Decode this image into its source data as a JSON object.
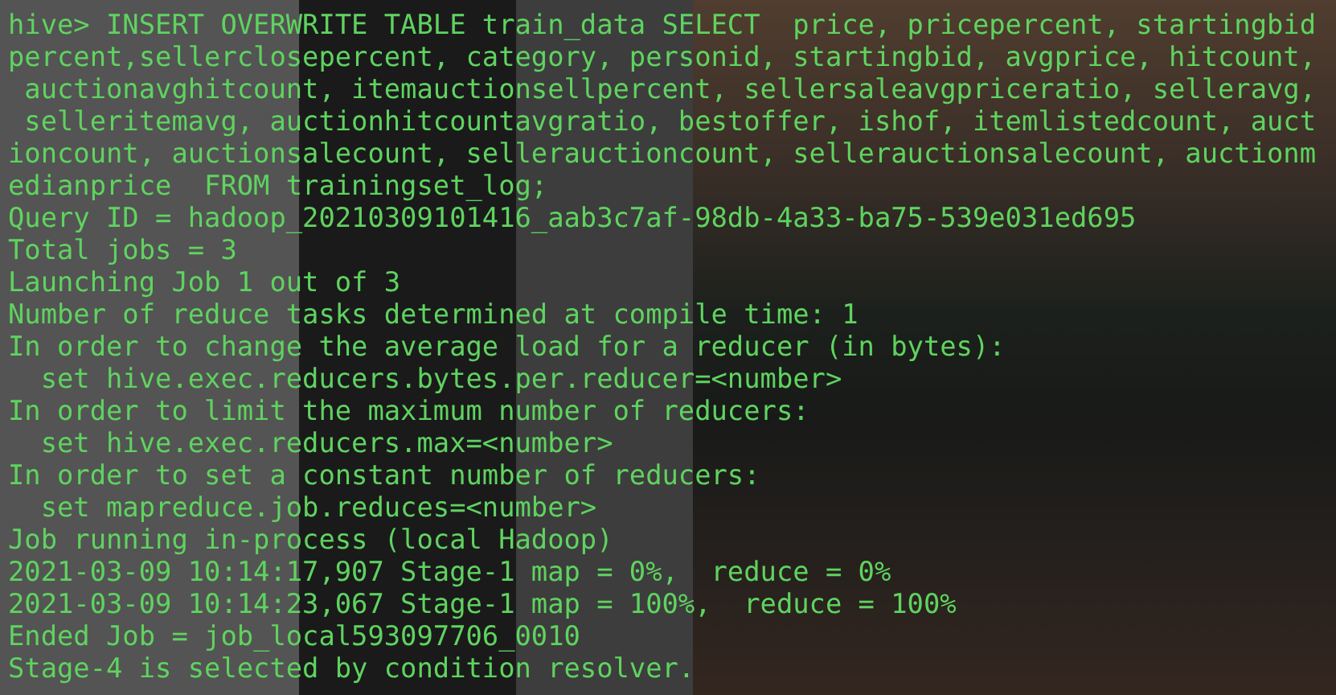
{
  "terminal": {
    "lines": [
      "hive> INSERT OVERWRITE TABLE train_data SELECT  price, pricepercent, startingbid",
      "percent,sellerclosepercent, category, personid, startingbid, avgprice, hitcount,",
      " auctionavghitcount, itemauctionsellpercent, sellersaleavgpriceratio, selleravg,",
      " selleritemavg, auctionhitcountavgratio, bestoffer, ishof, itemlistedcount, auct",
      "ioncount, auctionsalecount, sellerauctioncount, sellerauctionsalecount, auctionm",
      "edianprice  FROM trainingset_log;",
      "Query ID = hadoop_20210309101416_aab3c7af-98db-4a33-ba75-539e031ed695",
      "Total jobs = 3",
      "Launching Job 1 out of 3",
      "Number of reduce tasks determined at compile time: 1",
      "In order to change the average load for a reducer (in bytes):",
      "  set hive.exec.reducers.bytes.per.reducer=<number>",
      "In order to limit the maximum number of reducers:",
      "  set hive.exec.reducers.max=<number>",
      "In order to set a constant number of reducers:",
      "  set mapreduce.job.reduces=<number>",
      "Job running in-process (local Hadoop)",
      "2021-03-09 10:14:17,907 Stage-1 map = 0%,  reduce = 0%",
      "2021-03-09 10:14:23,067 Stage-1 map = 100%,  reduce = 100%",
      "Ended Job = job_local593097706_0010",
      "Stage-4 is selected by condition resolver."
    ]
  }
}
